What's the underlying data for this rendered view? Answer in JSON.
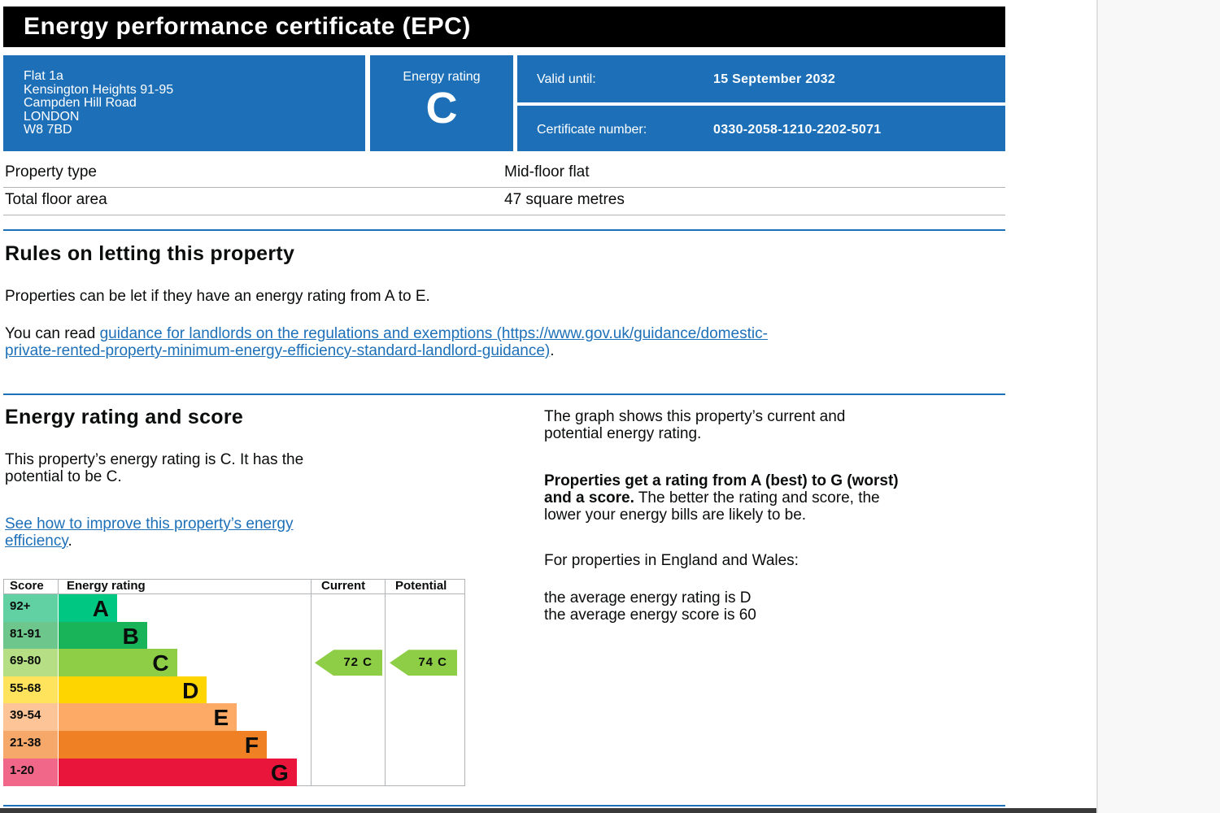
{
  "header": {
    "title": "Energy performance certificate (EPC)"
  },
  "address": {
    "lines": [
      "Flat 1a",
      "Kensington Heights 91-95",
      "Campden Hill Road",
      "LONDON",
      "W8 7BD"
    ]
  },
  "energy_rating": {
    "label": "Energy rating",
    "value": "C"
  },
  "valid_until": {
    "label": "Valid until:",
    "value": "15 September 2032"
  },
  "certificate": {
    "label": "Certificate number:",
    "value": "0330-2058-1210-2202-5071"
  },
  "property": {
    "type_label": "Property type",
    "type_value": "Mid-floor flat",
    "area_label": "Total floor area",
    "area_value": "47 square metres"
  },
  "letting": {
    "heading": "Rules on letting this property",
    "para1": "Properties can be let if they have an energy rating from A to E.",
    "para2_prefix": "You can read ",
    "link_line1": "guidance for landlords on the regulations and exemptions (https://www.gov.uk/guidance/domestic-",
    "link_line2": "private-rented-property-minimum-energy-efficiency-standard-landlord-guidance)",
    "para2_suffix": "."
  },
  "score_section": {
    "heading": "Energy rating and score",
    "rating_text_line1": "This property’s energy rating is C. It has the",
    "rating_text_line2": "potential to be C.",
    "improve_link_line1": "See how to improve this property’s energy",
    "improve_link_line2": "efficiency",
    "improve_suffix": ".",
    "graph_text_line1": "The graph shows this property’s current and",
    "graph_text_line2": "potential energy rating.",
    "bold_text_line1": "Properties get a rating from A (best) to G (worst)",
    "bold_text_line2": "and a score.",
    "normal_text_line2": " The better the rating and score, the",
    "normal_text_line3": "lower your energy bills are likely to be.",
    "england_wales": "For properties in England and Wales:",
    "avg_rating": "the average energy rating is D",
    "avg_score": "the average energy score is 60"
  },
  "chart_data": {
    "type": "bar",
    "headers": {
      "score": "Score",
      "rating": "Energy rating",
      "current": "Current",
      "potential": "Potential"
    },
    "bands": [
      {
        "score": "92+",
        "letter": "A",
        "color": "#00c781",
        "score_bg": "#61d0a2"
      },
      {
        "score": "81-91",
        "letter": "B",
        "color": "#19b459",
        "score_bg": "#6dc68b"
      },
      {
        "score": "69-80",
        "letter": "C",
        "color": "#8dce46",
        "score_bg": "#b5de85"
      },
      {
        "score": "55-68",
        "letter": "D",
        "color": "#ffd500",
        "score_bg": "#ffe35c"
      },
      {
        "score": "39-54",
        "letter": "E",
        "color": "#fcaa65",
        "score_bg": "#fdc597"
      },
      {
        "score": "21-38",
        "letter": "F",
        "color": "#ef8023",
        "score_bg": "#f5a86a"
      },
      {
        "score": "1-20",
        "letter": "G",
        "color": "#e9153b",
        "score_bg": "#f0678a"
      }
    ],
    "current": {
      "score": 72,
      "letter": "C",
      "label": "72 C"
    },
    "potential": {
      "score": 74,
      "letter": "C",
      "label": "74 C"
    }
  }
}
